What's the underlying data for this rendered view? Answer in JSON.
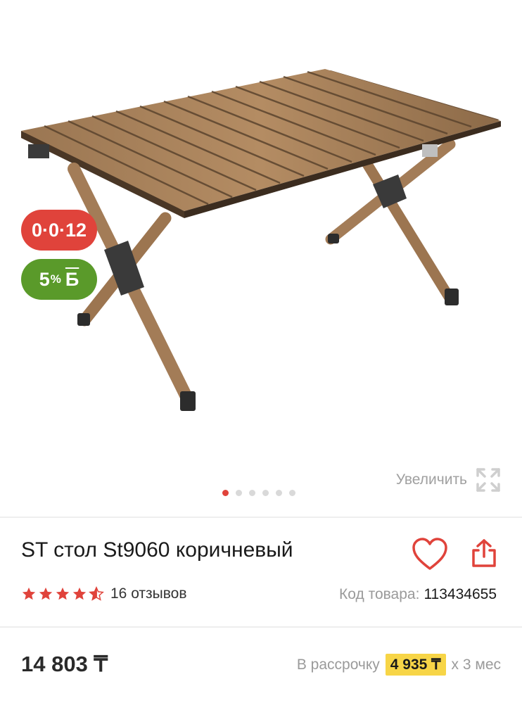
{
  "gallery": {
    "badge_installment": "0·0·12",
    "badge_bonus_value": "5",
    "badge_bonus_pct": "%",
    "badge_bonus_currency": "Б",
    "zoom_label": "Увеличить",
    "slide_count": 6,
    "active_slide": 1
  },
  "product": {
    "title": "ST стол St9060 коричневый",
    "rating": 4.5,
    "reviews": "16 отзывов",
    "sku_label": "Код товара:",
    "sku_value": "113434655"
  },
  "pricing": {
    "price": "14 803 ₸",
    "installment_label": "В рассрочку",
    "installment_amount": "4 935 ₸",
    "installment_term": "x 3 мес"
  },
  "colors": {
    "accent": "#e0433b",
    "bonus": "#5a9a2a",
    "highlight": "#f7d547"
  },
  "icons": [
    "heart-icon",
    "share-icon",
    "expand-icon",
    "star-icon"
  ]
}
